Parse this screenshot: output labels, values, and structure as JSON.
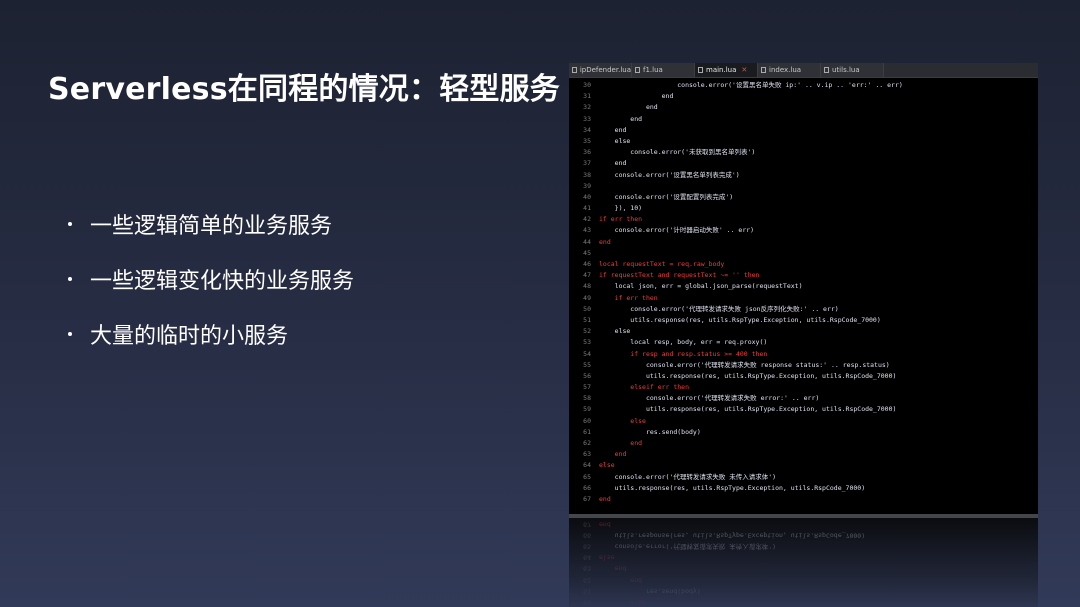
{
  "title": "Serverless在同程的情况：轻型服务",
  "bullets": [
    "一些逻辑简单的业务服务",
    "一些逻辑变化快的业务服务",
    "大量的临时的小服务"
  ],
  "editor": {
    "tabs": [
      {
        "label": "ipDefender.lua",
        "active": false
      },
      {
        "label": "f1.lua",
        "active": false
      },
      {
        "label": "main.lua",
        "active": true
      },
      {
        "label": "index.lua",
        "active": false
      },
      {
        "label": "utils.lua",
        "active": false
      }
    ],
    "lines": [
      {
        "n": "30",
        "text": "                    console.error('设置黑名单失败 ip:' .. v.ip .. 'err:' .. err)",
        "kw": false
      },
      {
        "n": "31",
        "text": "                end",
        "kw": false
      },
      {
        "n": "32",
        "text": "            end",
        "kw": false
      },
      {
        "n": "33",
        "text": "        end",
        "kw": false
      },
      {
        "n": "34",
        "text": "    end",
        "kw": false
      },
      {
        "n": "35",
        "text": "    else",
        "kw": false
      },
      {
        "n": "36",
        "text": "        console.error('未获取到黑名单列表')",
        "kw": false
      },
      {
        "n": "37",
        "text": "    end",
        "kw": false
      },
      {
        "n": "38",
        "text": "    console.error('设置黑名单列表完成')",
        "kw": false
      },
      {
        "n": "39",
        "text": "",
        "kw": false
      },
      {
        "n": "40",
        "text": "    console.error('设置配置列表完成')",
        "kw": false
      },
      {
        "n": "41",
        "text": "    }), 10)",
        "kw": false
      },
      {
        "n": "42",
        "text": "if err then",
        "kw": true
      },
      {
        "n": "43",
        "text": "    console.error('计时器启动失败' .. err)",
        "kw": false
      },
      {
        "n": "44",
        "text": "end",
        "kw": true
      },
      {
        "n": "45",
        "text": "",
        "kw": false
      },
      {
        "n": "46",
        "text": "local requestText = req.raw_body",
        "kw": true
      },
      {
        "n": "47",
        "text": "if requestText and requestText ~= '' then",
        "kw": true
      },
      {
        "n": "48",
        "text": "    local json, err = global.json_parse(requestText)",
        "kw": false
      },
      {
        "n": "49",
        "text": "    if err then",
        "kw": true
      },
      {
        "n": "50",
        "text": "        console.error('代理转发请求失败 json反序列化失败:' .. err)",
        "kw": false
      },
      {
        "n": "51",
        "text": "        utils.response(res, utils.RspType.Exception, utils.RspCode_7000)",
        "kw": false
      },
      {
        "n": "52",
        "text": "    else",
        "kw": false
      },
      {
        "n": "53",
        "text": "        local resp, body, err = req.proxy()",
        "kw": false
      },
      {
        "n": "54",
        "text": "        if resp and resp.status >= 400 then",
        "kw": true
      },
      {
        "n": "55",
        "text": "            console.error('代理转发请求失败 response status:' .. resp.status)",
        "kw": false
      },
      {
        "n": "56",
        "text": "            utils.response(res, utils.RspType.Exception, utils.RspCode_7000)",
        "kw": false
      },
      {
        "n": "57",
        "text": "        elseif err then",
        "kw": true
      },
      {
        "n": "58",
        "text": "            console.error('代理转发请求失败 error:' .. err)",
        "kw": false
      },
      {
        "n": "59",
        "text": "            utils.response(res, utils.RspType.Exception, utils.RspCode_7000)",
        "kw": false
      },
      {
        "n": "60",
        "text": "        else",
        "kw": true
      },
      {
        "n": "61",
        "text": "            res.send(body)",
        "kw": false
      },
      {
        "n": "62",
        "text": "        end",
        "kw": true
      },
      {
        "n": "63",
        "text": "    end",
        "kw": true
      },
      {
        "n": "64",
        "text": "else",
        "kw": true
      },
      {
        "n": "65",
        "text": "    console.error('代理转发请求失败 未传入请求体')",
        "kw": false
      },
      {
        "n": "66",
        "text": "    utils.response(res, utils.RspType.Exception, utils.RspCode_7000)",
        "kw": false
      },
      {
        "n": "67",
        "text": "end",
        "kw": true
      }
    ]
  }
}
